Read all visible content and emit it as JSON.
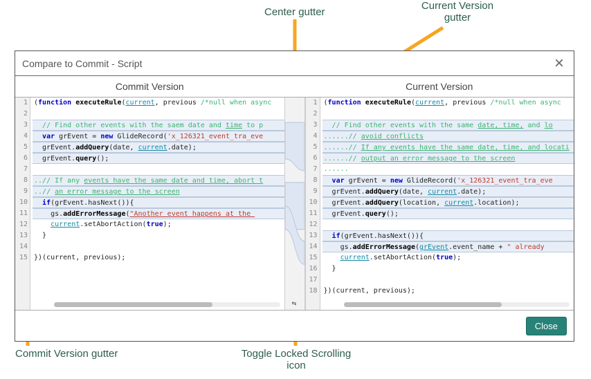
{
  "annotations": {
    "center_gutter": "Center gutter",
    "current_version_gutter": "Current Version\ngutter",
    "commit_version_gutter": "Commit Version gutter",
    "toggle_lock": "Toggle Locked Scrolling\nicon"
  },
  "dialog": {
    "title": "Compare to Commit - Script",
    "close_btn": "Close",
    "headings": {
      "left": "Commit Version",
      "right": "Current Version"
    }
  },
  "diff": {
    "left_lines": [
      {
        "n": 1,
        "cls": "",
        "html": "(<span class='tk-kw'>function</span> <span class='tk-fn'>executeRule</span>(<span class='tk-cur'>current</span>, previous <span class='tk-com'>/*null when async</span>"
      },
      {
        "n": 2,
        "cls": "",
        "html": ""
      },
      {
        "n": 3,
        "cls": "code-change",
        "html": "  <span class='tk-com'>// Find other events with the saem date and <u>time</u> to p</span>"
      },
      {
        "n": 4,
        "cls": "code-change",
        "html": "  <span class='tk-kw'>var</span> grEvent = <span class='tk-kw'>new</span> GlideRecord(<span class='tk-str'>'x_126321_event_tra_eve</span>"
      },
      {
        "n": 5,
        "cls": "code-change",
        "html": "  grEvent.<span class='tk-fn'>addQuery</span>(date, <span class='tk-cur'>current</span>.date);"
      },
      {
        "n": 6,
        "cls": "code-change",
        "html": "  grEvent.<span class='tk-fn'>query</span>();"
      },
      {
        "n": 7,
        "cls": "",
        "html": ""
      },
      {
        "n": 8,
        "cls": "code-change",
        "html": "<span class='tk-dots'>..</span><span class='tk-com'>// If any <u>events have the same date and time, abort t</u></span>"
      },
      {
        "n": 9,
        "cls": "code-change",
        "html": "<span class='tk-dots'>..</span><span class='tk-com'>// <u>an error message to the screen</u></span>"
      },
      {
        "n": 10,
        "cls": "code-change",
        "html": "  <span class='tk-kw'>if</span>(grEvent.hasNext()){"
      },
      {
        "n": 11,
        "cls": "code-change",
        "html": "    gs.<span class='tk-fn'>addErrorMessage</span>(<span class='tk-str'><u>\"Another event happens at the </u></span>"
      },
      {
        "n": 12,
        "cls": "",
        "html": "    <span class='tk-cur'>current</span>.setAbortAction(<span class='tk-kw'>true</span>);"
      },
      {
        "n": 13,
        "cls": "",
        "html": "  }"
      },
      {
        "n": 14,
        "cls": "",
        "html": ""
      },
      {
        "n": 15,
        "cls": "",
        "html": "})(current, previous);"
      }
    ],
    "right_lines": [
      {
        "n": 1,
        "cls": "",
        "html": "(<span class='tk-kw'>function</span> <span class='tk-fn'>executeRule</span>(<span class='tk-cur'>current</span>, previous <span class='tk-com'>/*null when async</span>"
      },
      {
        "n": 2,
        "cls": "",
        "html": ""
      },
      {
        "n": 3,
        "cls": "code-change",
        "html": "  <span class='tk-com'>// Find other events with the same <u>date, time,</u> and <u>lo</u></span>"
      },
      {
        "n": 4,
        "cls": "code-change",
        "html": "<span class='tk-dots'>......</span><span class='tk-com'>// <u>avoid conflicts</u></span>"
      },
      {
        "n": 5,
        "cls": "code-change",
        "html": "<span class='tk-dots'>......</span><span class='tk-com'>// <u>If any events have the same date, time, and locati</u></span>"
      },
      {
        "n": 6,
        "cls": "code-change",
        "html": "<span class='tk-dots'>......</span><span class='tk-com'>// <u>output an error message to the screen</u></span>"
      },
      {
        "n": 7,
        "cls": "",
        "html": "<span class='tk-dots'>......</span>"
      },
      {
        "n": 8,
        "cls": "code-change",
        "html": "  <span class='tk-kw'>var</span> grEvent = <span class='tk-kw'>new</span> GlideRecord(<span class='tk-str'>'x_126321_event_tra_eve</span>"
      },
      {
        "n": 9,
        "cls": "code-change",
        "html": "  grEvent.<span class='tk-fn'>addQuery</span>(date, <span class='tk-cur'>current</span>.date);"
      },
      {
        "n": 10,
        "cls": "code-change",
        "html": "  grEvent.<span class='tk-fn'>addQuery</span>(location, <span class='tk-cur'>current</span>.location);"
      },
      {
        "n": 11,
        "cls": "code-change",
        "html": "  grEvent.<span class='tk-fn'>query</span>();"
      },
      {
        "n": 12,
        "cls": "",
        "html": ""
      },
      {
        "n": 13,
        "cls": "code-change",
        "html": "  <span class='tk-kw'>if</span>(grEvent.hasNext()){"
      },
      {
        "n": 14,
        "cls": "code-change",
        "html": "    gs.<span class='tk-fn'>addErrorMessage</span>(<span class='tk-cur'><u>grEvent</u></span>.event_name + <span class='tk-str'>\" already</span>"
      },
      {
        "n": 15,
        "cls": "",
        "html": "    <span class='tk-cur'>current</span>.setAbortAction(<span class='tk-kw'>true</span>);"
      },
      {
        "n": 16,
        "cls": "",
        "html": "  }"
      },
      {
        "n": 17,
        "cls": "",
        "html": ""
      },
      {
        "n": 18,
        "cls": "",
        "html": "})(current, previous);"
      }
    ]
  },
  "colors": {
    "accent": "#278277",
    "arrow": "#f5a623",
    "label": "#2d5c4d"
  }
}
